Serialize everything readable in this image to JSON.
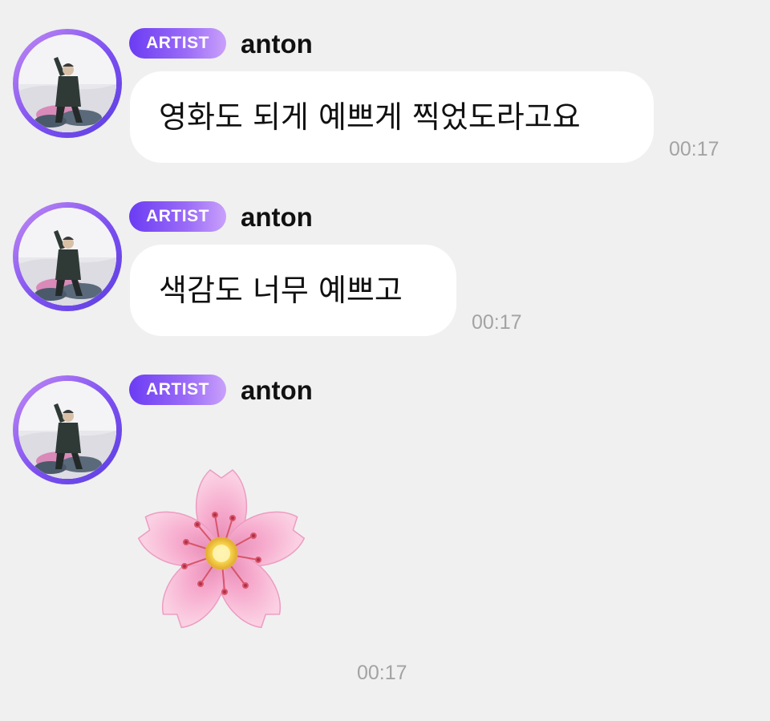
{
  "colors": {
    "background": "#f0f0f0",
    "bubble": "#ffffff",
    "badge_start": "#6b3cf3",
    "badge_end": "#c9a0fb",
    "timestamp": "#a3a3a3"
  },
  "messages": [
    {
      "badge": "ARTIST",
      "sender": "anton",
      "avatar_icon": "profile-photo",
      "text": "영화도 되게 예쁘게 찍었도라고요",
      "time": "00:17"
    },
    {
      "badge": "ARTIST",
      "sender": "anton",
      "avatar_icon": "profile-photo",
      "text": "색감도 너무 예쁘고",
      "time": "00:17"
    },
    {
      "badge": "ARTIST",
      "sender": "anton",
      "avatar_icon": "profile-photo",
      "emoji": "cherry-blossom-icon",
      "time": "00:17"
    }
  ]
}
